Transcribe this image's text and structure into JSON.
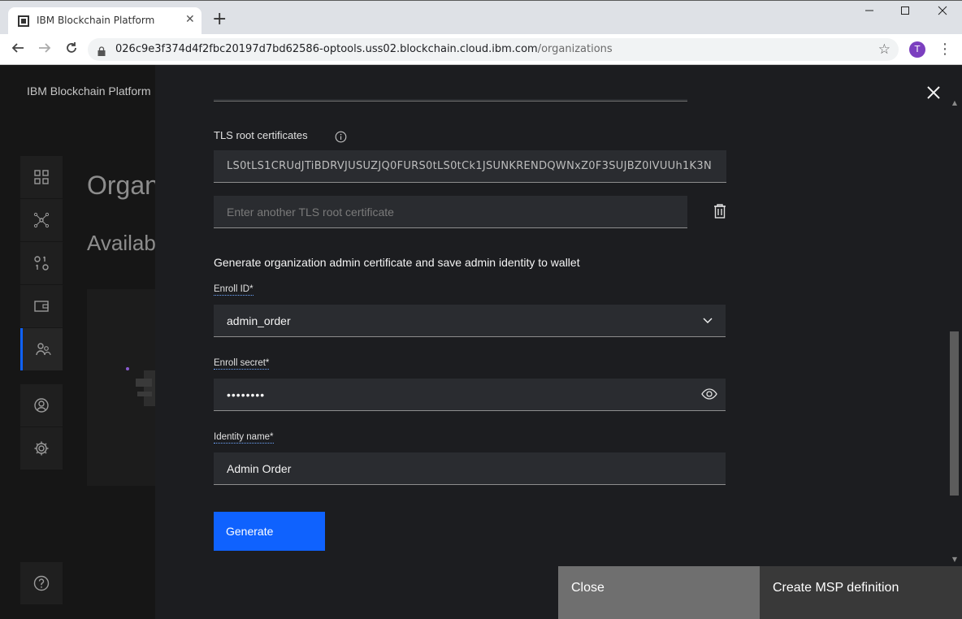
{
  "browser": {
    "tab_title": "IBM Blockchain Platform",
    "tab_close": "✕",
    "new_tab": "+",
    "url_host": "026c9e3f374d4f2fbc20197d7bd62586-optools.uss02.blockchain.cloud.ibm.com",
    "url_path": "/organizations",
    "profile_initial": "T",
    "icons": [
      "back-icon",
      "forward-icon",
      "reload-icon",
      "lock-icon",
      "star-icon",
      "kebab-menu-icon"
    ]
  },
  "app": {
    "title": "IBM Blockchain Platform",
    "bg_heading": "Organ",
    "bg_subheading": "Availab"
  },
  "panel": {
    "tls_label": "TLS root certificates",
    "tls_value": "LS0tLS1CRUdJTiBDRVJUSUZJQ0FURS0tLS0tCk1JSUNKRENDQWNxZ0F3SUJBZ0lVUUh1K3N",
    "tls_placeholder": "Enter another TLS root certificate",
    "section_text": "Generate organization admin certificate and save admin identity to wallet",
    "enroll_id_label": "Enroll ID*",
    "enroll_id_value": "admin_order",
    "enroll_secret_label": "Enroll secret*",
    "enroll_secret_value": "••••••••",
    "identity_label": "Identity name*",
    "identity_value": "Admin Order",
    "generate_label": "Generate",
    "close_label": "Close",
    "create_label": "Create MSP definition"
  },
  "colors": {
    "primary": "#0f62fe",
    "panel_bg": "#1c1d20",
    "field_bg": "#2a2c30"
  }
}
